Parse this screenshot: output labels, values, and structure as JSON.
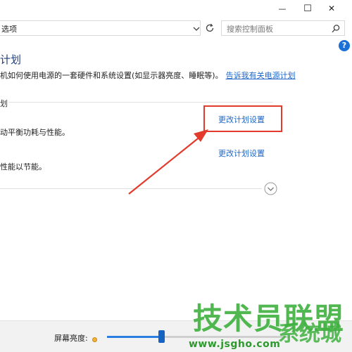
{
  "window": {
    "minimize_glyph": "—",
    "maximize_glyph": "☐",
    "close_glyph": "✕"
  },
  "address_bar": {
    "path_fragment": "选项"
  },
  "search": {
    "placeholder": "搜索控制面板"
  },
  "help_glyph": "?",
  "page": {
    "title": "计划",
    "description": "机如何使用电源的一套硬件和系统设置(如显示器亮度、睡眠等)。",
    "description_link": "告诉我有关电源计划"
  },
  "plans": {
    "section_label": "划",
    "plan1_description": "动平衡功耗与性能。",
    "plan1_link": "更改计划设置",
    "plan2_description": "性能以节能。",
    "plan2_link": "更改计划设置"
  },
  "bottom": {
    "brightness_label": "屏幕亮度:",
    "brightness_level_percent": 30
  },
  "watermark": {
    "line1": "技术员联盟",
    "line2": "系统城",
    "url": "www.jsgho.com"
  },
  "colors": {
    "accent": "#1e66c9",
    "highlight": "#e23b2e",
    "watermark": "#3fb13f"
  }
}
